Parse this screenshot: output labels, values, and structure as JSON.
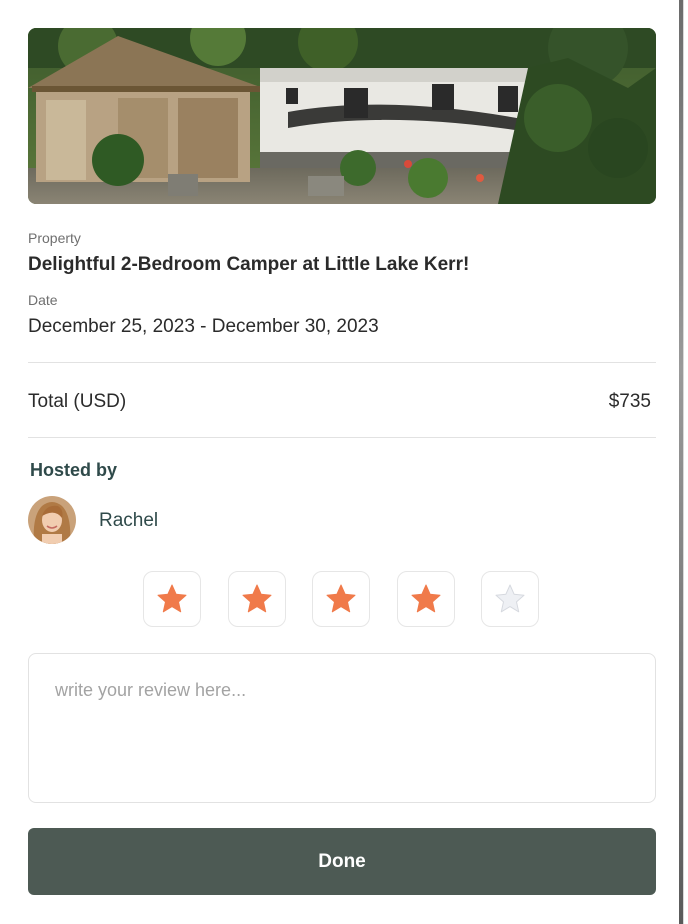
{
  "booking": {
    "property_label": "Property",
    "property_name": "Delightful 2-Bedroom Camper at Little Lake Kerr!",
    "date_label": "Date",
    "date_range": "December 25, 2023 - December 30, 2023",
    "total_label": "Total (USD)",
    "total_value": "$735"
  },
  "host": {
    "heading": "Hosted by",
    "name": "Rachel"
  },
  "rating": {
    "value": 4,
    "max": 5,
    "filled_color": "#f07a4a",
    "empty_color": "#eef0f4"
  },
  "review": {
    "placeholder": "write your review here...",
    "value": ""
  },
  "actions": {
    "done_label": "Done",
    "done_color": "#4d5a54"
  },
  "icons": {
    "star": "star-icon"
  }
}
